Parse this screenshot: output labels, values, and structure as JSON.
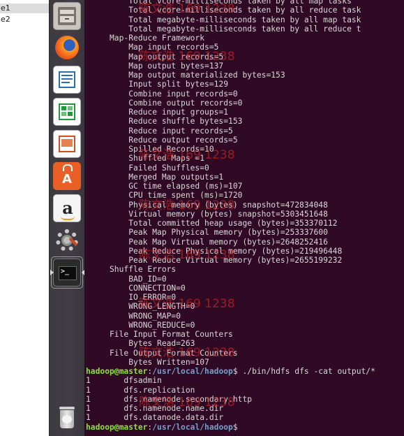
{
  "left_window": {
    "rows": [
      "e1",
      "e2"
    ]
  },
  "launcher": {
    "icons": [
      {
        "name": "files-icon"
      },
      {
        "name": "firefox-icon"
      },
      {
        "name": "writer-icon"
      },
      {
        "name": "calc-icon"
      },
      {
        "name": "impress-icon"
      },
      {
        "name": "software-center-icon"
      },
      {
        "name": "amazon-icon"
      },
      {
        "name": "system-settings-icon"
      },
      {
        "name": "terminal-icon"
      },
      {
        "name": "trash-icon"
      }
    ]
  },
  "terminal": {
    "lines": [
      "         Total vcore-milliseconds taken by all map tasks",
      "         Total vcore-milliseconds taken by all reduce task",
      "         Total megabyte-milliseconds taken by all map task",
      "         Total megabyte-milliseconds taken by all reduce t",
      "     Map-Reduce Framework",
      "         Map input records=5",
      "         Map output records=5",
      "         Map output bytes=137",
      "         Map output materialized bytes=153",
      "         Input split bytes=129",
      "         Combine input records=0",
      "         Combine output records=0",
      "         Reduce input groups=1",
      "         Reduce shuffle bytes=153",
      "         Reduce input records=5",
      "         Reduce output records=5",
      "         Spilled Records=10",
      "         Shuffled Maps =1",
      "         Failed Shuffles=0",
      "         Merged Map outputs=1",
      "         GC time elapsed (ms)=107",
      "         CPU time spent (ms)=1720",
      "         Physical memory (bytes) snapshot=472834048",
      "         Virtual memory (bytes) snapshot=5303451648",
      "         Total committed heap usage (bytes)=353370112",
      "         Peak Map Physical memory (bytes)=253337600",
      "         Peak Map Virtual memory (bytes)=2648252416",
      "         Peak Reduce Physical memory (bytes)=219496448",
      "         Peak Reduce Virtual memory (bytes)=2655199232",
      "     Shuffle Errors",
      "         BAD_ID=0",
      "         CONNECTION=0",
      "         IO_ERROR=0",
      "         WRONG_LENGTH=0",
      "         WRONG_MAP=0",
      "         WRONG_REDUCE=0",
      "     File Input Format Counters",
      "         Bytes Read=263",
      "     File Output Format Counters",
      "         Bytes Written=107"
    ],
    "command": {
      "user_host": "hadoop@master",
      "sep": ":",
      "path": "/usr/local/hadoop",
      "symbol": "$",
      "text": " ./bin/hdfs dfs -cat output/*"
    },
    "output_lines": [
      "1       dfsadmin",
      "1       dfs.replication",
      "1       dfs.namenode.secondary.http",
      "1       dfs.namenode.name.dir",
      "1       dfs.datanode.data.dir"
    ],
    "final_prompt": {
      "user_host": "hadoop@master",
      "sep": ":",
      "path": "/usr/local/hadoop",
      "symbol": "$"
    },
    "watermark_text": "陈文浩 169 1238"
  },
  "colors": {
    "terminal_bg": "#300a24",
    "prompt_user": "#8ae234",
    "prompt_path": "#729fcf",
    "watermark": "#d62828"
  }
}
